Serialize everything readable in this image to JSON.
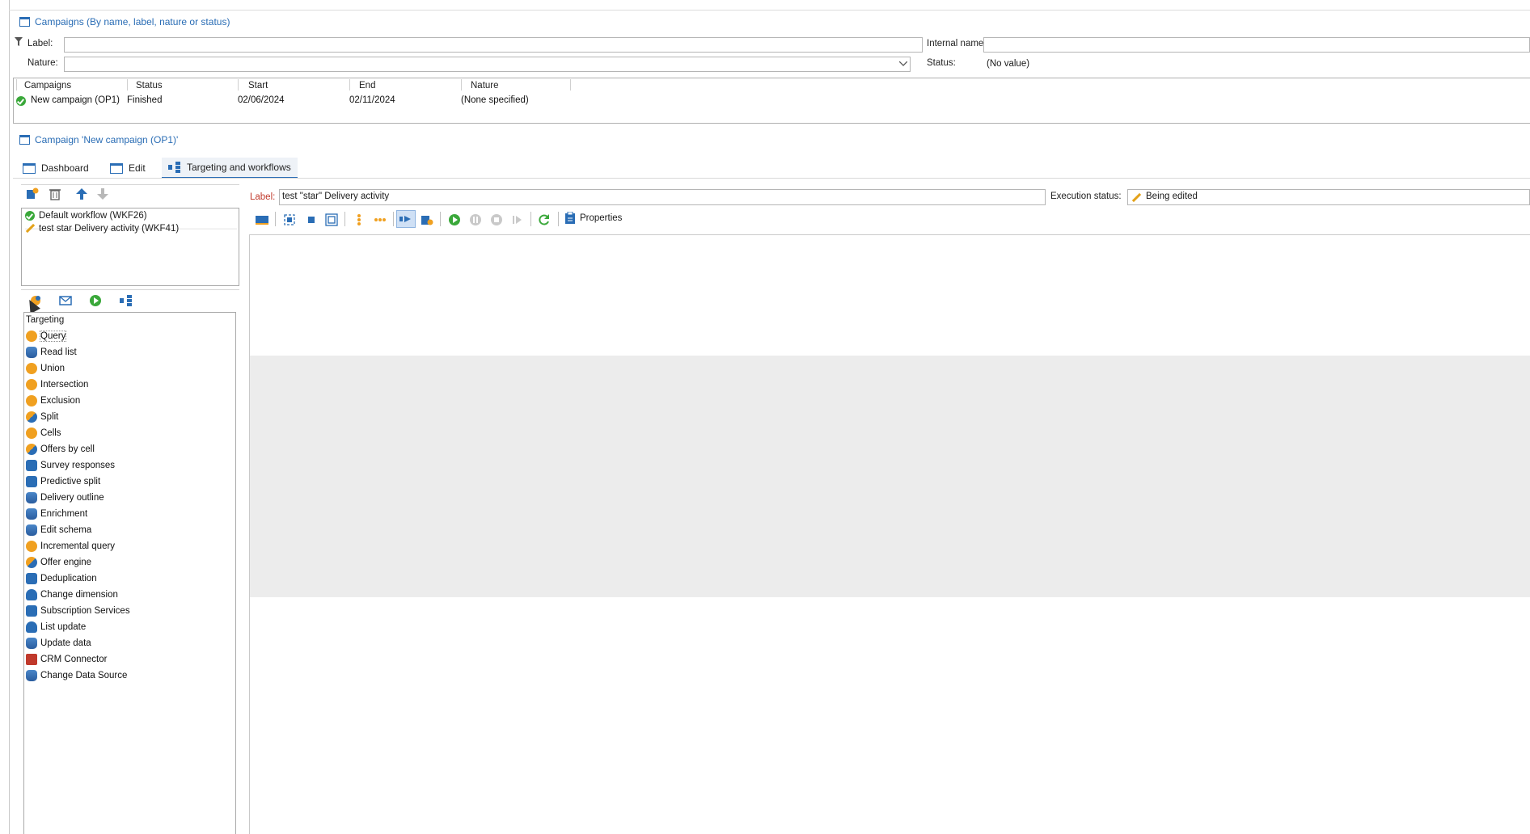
{
  "search": {
    "title": "Campaigns (By name, label, nature or status)",
    "label_caption": "Label:",
    "label_value": "",
    "internal_name_caption": "Internal name:",
    "internal_name_value": "",
    "nature_caption": "Nature:",
    "nature_value": "",
    "status_caption": "Status:",
    "status_value": "(No value)"
  },
  "campaign_list": {
    "columns": [
      "Campaigns",
      "Status",
      "Start",
      "End",
      "Nature"
    ],
    "rows": [
      {
        "campaign": "New campaign (OP1)",
        "status": "Finished",
        "start": "02/06/2024",
        "end": "02/11/2024",
        "nature": "(None specified)"
      }
    ]
  },
  "campaign": {
    "title": "Campaign 'New campaign (OP1)'",
    "tabs": [
      {
        "label": "Dashboard",
        "icon": "dashboard-icon"
      },
      {
        "label": "Edit",
        "icon": "edit-form-icon"
      },
      {
        "label": "Targeting and workflows",
        "icon": "workflow-icon",
        "active": true
      }
    ]
  },
  "workflows": {
    "items": [
      {
        "label": "Default workflow (WKF26)",
        "icon": "check-icon"
      },
      {
        "label": "test star Delivery activity (WKF41)",
        "icon": "pencil-icon"
      }
    ]
  },
  "editor": {
    "label_caption": "Label:",
    "label_value": "test \"star\" Delivery activity",
    "execution_status_caption": "Execution status:",
    "execution_status_value": "Being edited",
    "properties_label": "Properties"
  },
  "palette": {
    "heading": "Targeting",
    "items": [
      {
        "label": "Query",
        "icon": "query-icon"
      },
      {
        "label": "Read list",
        "icon": "read-list-icon"
      },
      {
        "label": "Union",
        "icon": "union-icon"
      },
      {
        "label": "Intersection",
        "icon": "intersection-icon"
      },
      {
        "label": "Exclusion",
        "icon": "exclusion-icon"
      },
      {
        "label": "Split",
        "icon": "split-icon"
      },
      {
        "label": "Cells",
        "icon": "cells-icon"
      },
      {
        "label": "Offers by cell",
        "icon": "offers-by-cell-icon"
      },
      {
        "label": "Survey responses",
        "icon": "survey-icon"
      },
      {
        "label": "Predictive split",
        "icon": "predictive-split-icon"
      },
      {
        "label": "Delivery outline",
        "icon": "delivery-outline-icon"
      },
      {
        "label": "Enrichment",
        "icon": "enrichment-icon"
      },
      {
        "label": "Edit schema",
        "icon": "edit-schema-icon"
      },
      {
        "label": "Incremental query",
        "icon": "incremental-query-icon"
      },
      {
        "label": "Offer engine",
        "icon": "offer-engine-icon"
      },
      {
        "label": "Deduplication",
        "icon": "deduplication-icon"
      },
      {
        "label": "Change dimension",
        "icon": "change-dimension-icon"
      },
      {
        "label": "Subscription Services",
        "icon": "subscription-icon"
      },
      {
        "label": "List update",
        "icon": "list-update-icon"
      },
      {
        "label": "Update data",
        "icon": "update-data-icon"
      },
      {
        "label": "CRM Connector",
        "icon": "crm-connector-icon"
      },
      {
        "label": "Change Data Source",
        "icon": "change-data-source-icon"
      }
    ]
  }
}
